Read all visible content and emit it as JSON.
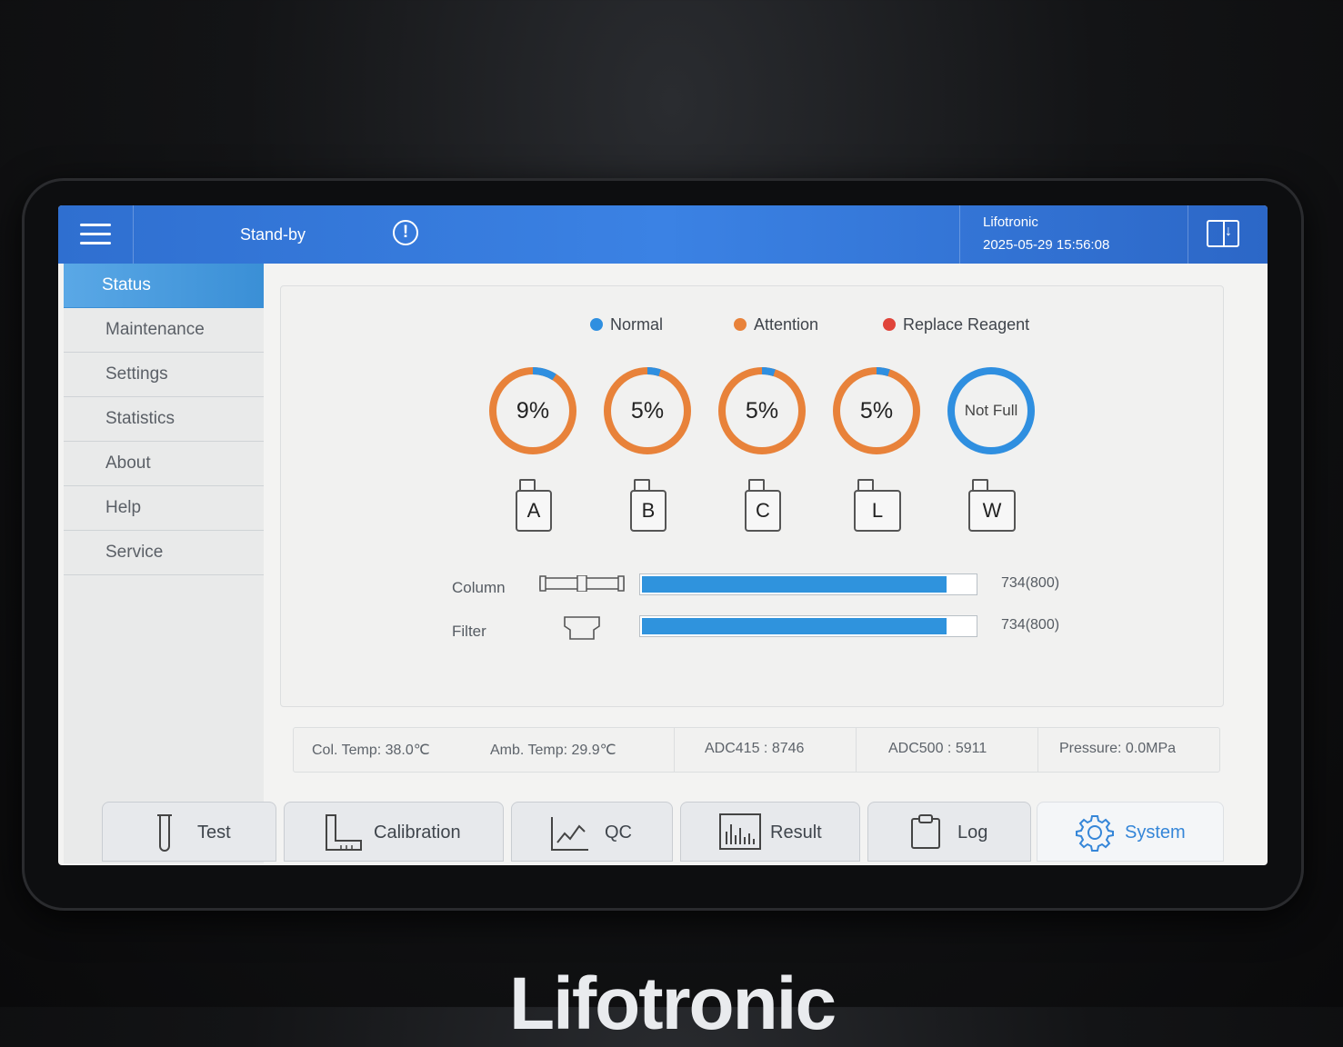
{
  "header": {
    "status": "Stand-by",
    "brand": "Lifotronic",
    "datetime": "2025-05-29 15:56:08"
  },
  "sidebar": {
    "items": [
      {
        "label": "Status",
        "active": true
      },
      {
        "label": "Maintenance"
      },
      {
        "label": "Settings"
      },
      {
        "label": "Statistics"
      },
      {
        "label": "About"
      },
      {
        "label": "Help"
      },
      {
        "label": "Service"
      }
    ]
  },
  "legend": [
    {
      "label": "Normal",
      "color": "#2f8fe0"
    },
    {
      "label": "Attention",
      "color": "#e8823a"
    },
    {
      "label": "Replace Reagent",
      "color": "#e0443a"
    }
  ],
  "reagents": [
    {
      "value": "9%",
      "letter": "A",
      "level": 0.09,
      "status": "attention"
    },
    {
      "value": "5%",
      "letter": "B",
      "level": 0.05,
      "status": "attention"
    },
    {
      "value": "5%",
      "letter": "C",
      "level": 0.05,
      "status": "attention"
    },
    {
      "value": "5%",
      "letter": "L",
      "level": 0.05,
      "status": "attention"
    },
    {
      "value": "Not Full",
      "letter": "W",
      "level": 1.0,
      "status": "normal"
    }
  ],
  "consumables": [
    {
      "label": "Column",
      "value": "734(800)",
      "used": 734,
      "total": 800
    },
    {
      "label": "Filter",
      "value": "734(800)",
      "used": 734,
      "total": 800
    }
  ],
  "readings": [
    "Col. Temp:  38.0℃",
    "Amb. Temp:  29.9℃",
    "ADC415 : 8746",
    "ADC500 : 5911",
    "Pressure:  0.0MPa"
  ],
  "tabs": [
    {
      "label": "Test",
      "icon": "test-tube-icon"
    },
    {
      "label": "Calibration",
      "icon": "calibration-icon"
    },
    {
      "label": "QC",
      "icon": "line-chart-icon"
    },
    {
      "label": "Result",
      "icon": "histogram-icon"
    },
    {
      "label": "Log",
      "icon": "clipboard-icon"
    },
    {
      "label": "System",
      "icon": "gear-icon",
      "active": true
    }
  ],
  "device_brand": "Lifotronic"
}
